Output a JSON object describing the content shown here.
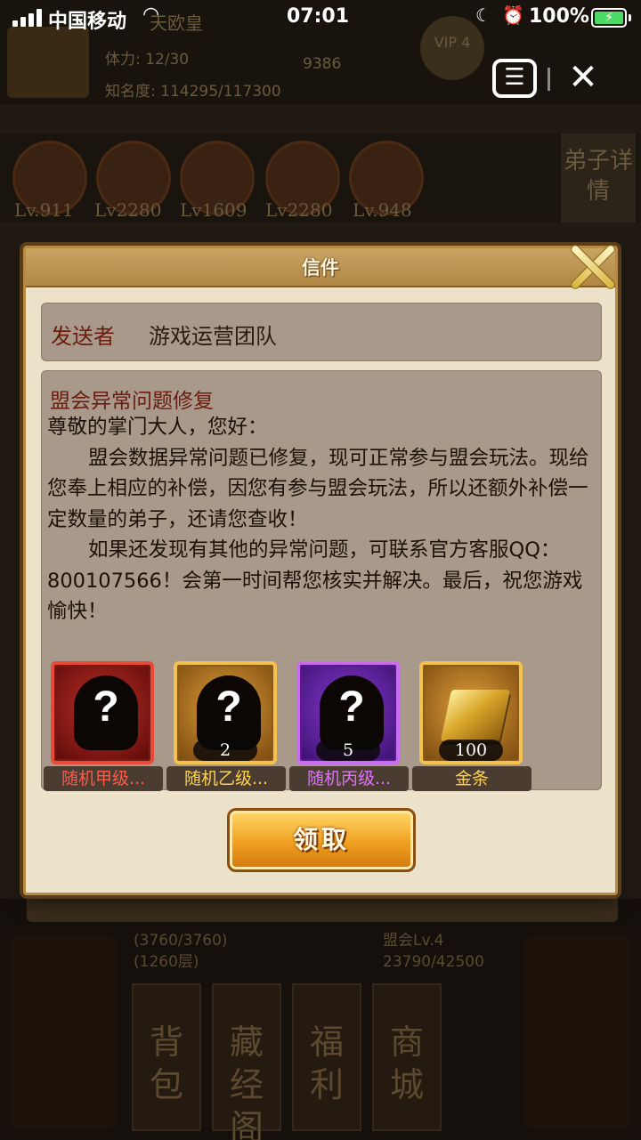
{
  "status_bar": {
    "carrier": "中国移动",
    "time": "07:01",
    "battery": "100%"
  },
  "background": {
    "player_name": "天欧皇",
    "stamina": "体力: 12/30",
    "fame": "知名度: 114295/117300",
    "money": "9386",
    "vip": "VIP 4",
    "hero_levels": [
      "Lv.911",
      "Lv2280",
      "Lv1609",
      "Lv2280",
      "Lv.948"
    ],
    "disciple_details": "弟子详情",
    "tower_progress": "(3760/3760)",
    "tower_floor": "(1260层)",
    "league_level": "盟会Lv.4",
    "league_exp": "23790/42500",
    "nav_tiles": [
      "背包",
      "藏经阁",
      "福利",
      "商城"
    ]
  },
  "capsule": {
    "menu_icon": "menu-icon",
    "close_icon": "close-icon"
  },
  "dialog": {
    "title": "信件",
    "sender_label": "发送者",
    "sender_value": "游戏运营团队",
    "subject": "盟会异常问题修复",
    "body": [
      "尊敬的掌门大人，您好：",
      "盟会数据异常问题已修复，现可正常参与盟会玩法。现给您奉上相应的补偿，因您有参与盟会玩法，所以还额外补偿一定数量的弟子，还请您查收！",
      "如果还发现有其他的异常问题，可联系官方客服QQ：800107566！会第一时间帮您核实并解决。最后，祝您游戏愉快！"
    ],
    "rewards": [
      {
        "name": "随机甲级...",
        "qty": "",
        "tier": "red",
        "icon": "mystery-disciple-icon"
      },
      {
        "name": "随机乙级...",
        "qty": "2",
        "tier": "gold",
        "icon": "mystery-disciple-icon"
      },
      {
        "name": "随机丙级...",
        "qty": "5",
        "tier": "purple",
        "icon": "mystery-disciple-icon"
      },
      {
        "name": "金条",
        "qty": "100",
        "tier": "gold",
        "icon": "gold-bar-icon"
      }
    ],
    "claim_label": "领取"
  },
  "colors": {
    "dialog_bg": "#ece1c9",
    "panel_bg": "#a8998a",
    "accent_red": "#6a1c10",
    "button_orange": "#f0a020"
  }
}
